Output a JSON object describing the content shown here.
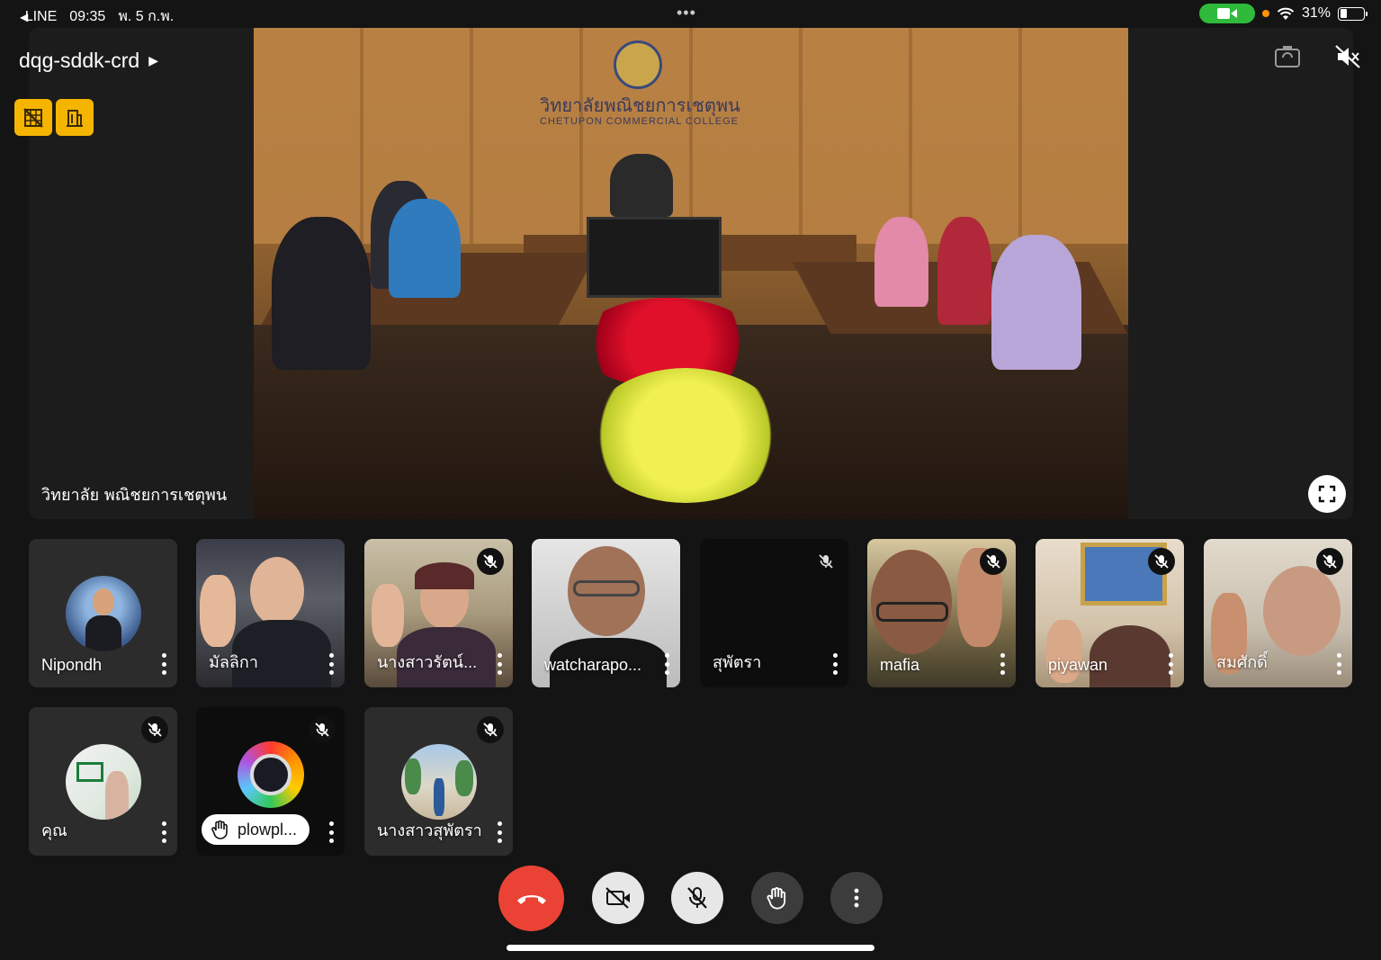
{
  "status_bar": {
    "back_app": "LINE",
    "time": "09:35",
    "date": "พ. 5 ก.พ.",
    "battery": "31%",
    "battery_level": 0.31
  },
  "meeting": {
    "code": "dqg-sddk-crd",
    "stage_label": "วิทยาลัย พณิชยการเชตุพน",
    "wall_text_th": "วิทยาลัยพณิชยการเชตุพน",
    "wall_text_en": "CHETUPON COMMERCIAL COLLEGE"
  },
  "participants": [
    {
      "name": "Nipondh",
      "muted": false,
      "type": "avatar"
    },
    {
      "name": "มัลลิกา",
      "muted": false,
      "type": "video"
    },
    {
      "name": "นางสาวรัตน์...",
      "muted": true,
      "type": "video"
    },
    {
      "name": "watcharapo...",
      "muted": false,
      "type": "video"
    },
    {
      "name": "สุพัตรา",
      "muted": true,
      "type": "blank"
    },
    {
      "name": "mafia",
      "muted": true,
      "type": "video"
    },
    {
      "name": "piyawan",
      "muted": true,
      "type": "video"
    },
    {
      "name": "สมศักดิ์",
      "muted": true,
      "type": "video"
    },
    {
      "name": "คุณ",
      "muted": true,
      "type": "avatar"
    },
    {
      "name": "plowpl...",
      "muted": true,
      "type": "avatar",
      "hand_raised": true
    },
    {
      "name": "นางสาวสุพัตรา",
      "muted": true,
      "type": "avatar"
    }
  ],
  "icons": {
    "end_call": "phone-hangup-icon",
    "camera": "camera-off-icon",
    "mic": "mic-off-icon",
    "hand": "raise-hand-icon",
    "more": "more-vert-icon"
  },
  "colors": {
    "end_call": "#ea4335",
    "accent_yellow": "#f4b400",
    "camera_pill": "#2fba3c"
  }
}
